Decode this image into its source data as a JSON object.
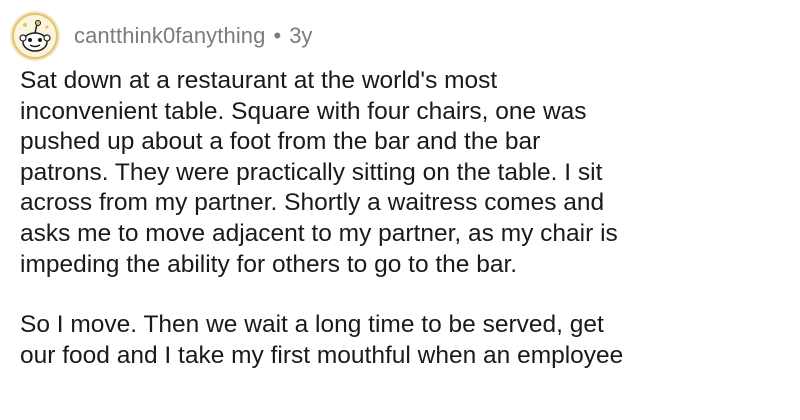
{
  "comment": {
    "author": "cantthink0fanything",
    "separator": "•",
    "age": "3y",
    "paragraphs": [
      {
        "lines": [
          "Sat down at a restaurant at the world's most",
          "inconvenient table. Square with four chairs, one was",
          "pushed up about a foot from the bar and the bar",
          "patrons. They were practically sitting on the table. I sit",
          "across from my partner. Shortly a waitress comes and",
          "asks me to move adjacent to my partner, as my chair is",
          "impeding the ability for others to go to the bar."
        ]
      },
      {
        "lines": [
          "So I move. Then we wait a long time to be served, get",
          "our food and I take my first mouthful when an employee"
        ]
      }
    ]
  },
  "icons": {
    "avatar": "snoo-avatar-icon"
  },
  "colors": {
    "meta_text": "#7c7c7c",
    "body_text": "#1a1a1b",
    "avatar_bg": "#f3e7c2",
    "avatar_accent": "#e2c46a"
  }
}
